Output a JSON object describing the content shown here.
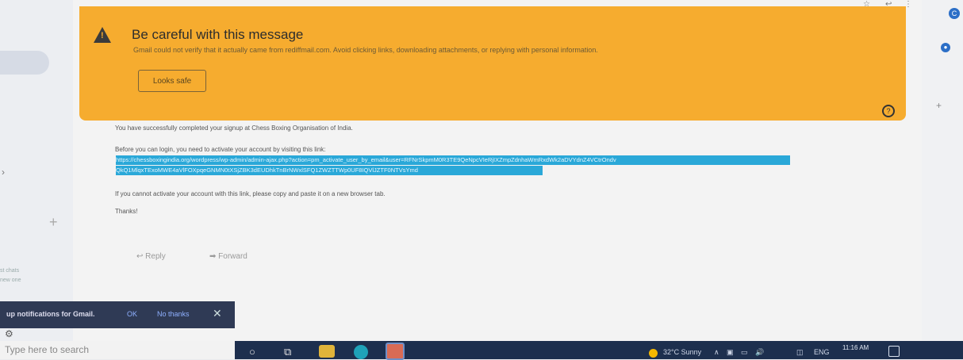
{
  "warning": {
    "title": "Be careful with this message",
    "body": "Gmail could not verify that it actually came from rediffmail.com. Avoid clicking links, downloading attachments, or replying with personal information.",
    "button": "Looks safe"
  },
  "message": {
    "line1": "You have successfully completed your signup at Chess Boxing Organisation of India.",
    "line2": "Before you can login, you need to activate your account by visiting this link:",
    "link_part1": "https://chessboxingindia.org/wordpress/wp-admin/admin-ajax.php?action=pm_activate_user_by_email&user=RFNrSkpmM0R3TE9QeNpcVIeRjIXZmpZdnhaWmRxdWk2aDVYdnZ4VCtrOndv",
    "link_part2": "QkQ1MlqxTExoMWE4aVlFOXpqeGNMN0tXSjZBK3dEUDhkTnBrNWxlSFQ1ZWZTTWp0UF8IQVlJZTF0NTVsYmd",
    "line3": "If you cannot activate your account with this link, please copy and paste it on a new browser tab.",
    "thanks": "Thanks!",
    "reply": "Reply",
    "forward": "Forward"
  },
  "left": {
    "small1": "st chats",
    "small2": "new one"
  },
  "toast": {
    "text": "up notifications for Gmail.",
    "ok": "OK",
    "no": "No thanks",
    "close": "✕"
  },
  "taskbar": {
    "search_placeholder": "Type here to search",
    "weather": "32°C  Sunny",
    "lang": "ENG",
    "time": "11:16 AM"
  }
}
